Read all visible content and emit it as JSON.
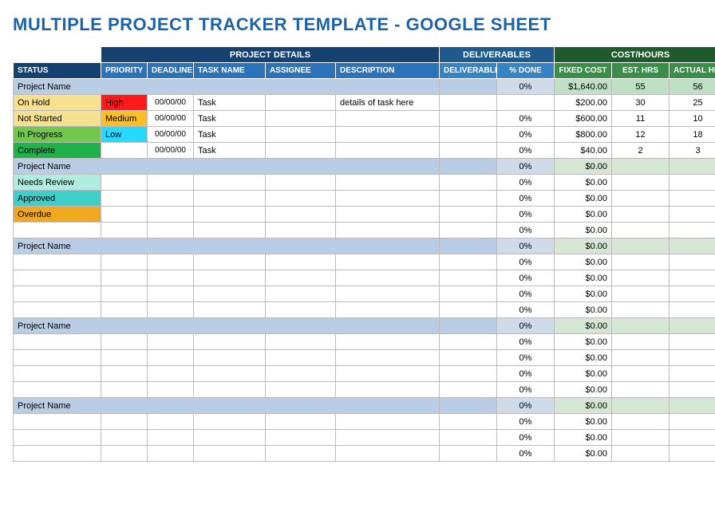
{
  "title": "MULTIPLE PROJECT TRACKER TEMPLATE - GOOGLE SHEET",
  "groups": {
    "project_details": "PROJECT DETAILS",
    "deliverables": "DELIVERABLES",
    "cost_hours": "COST/HOURS"
  },
  "cols": {
    "status": "STATUS",
    "priority": "PRIORITY",
    "deadline": "DEADLINE",
    "task": "TASK NAME",
    "assignee": "ASSIGNEE",
    "desc": "DESCRIPTION",
    "deliverable": "DELIVERABLE",
    "done": "% DONE",
    "cost": "FIXED COST",
    "est": "EST. HRS",
    "act": "ACTUAL HRS"
  },
  "projects": [
    {
      "name": "Project Name",
      "first": true,
      "done": "0%",
      "cost": "$1,640.00",
      "est": "55",
      "act": "56",
      "rows": [
        {
          "status": "On Hold",
          "status_cls": "st-onhold",
          "priority": "High",
          "priority_cls": "pr-high",
          "deadline": "00/00/00",
          "task": "Task",
          "assignee": "",
          "desc": "details of task here",
          "deliv": "",
          "done": "",
          "cost": "$200.00",
          "est": "30",
          "act": "25"
        },
        {
          "status": "Not Started",
          "status_cls": "st-notstart",
          "priority": "Medium",
          "priority_cls": "pr-medium",
          "deadline": "00/00/00",
          "task": "Task",
          "assignee": "",
          "desc": "",
          "deliv": "",
          "done": "0%",
          "cost": "$600.00",
          "est": "11",
          "act": "10"
        },
        {
          "status": "In Progress",
          "status_cls": "st-inprog",
          "priority": "Low",
          "priority_cls": "pr-low",
          "deadline": "00/00/00",
          "task": "Task",
          "assignee": "",
          "desc": "",
          "deliv": "",
          "done": "0%",
          "cost": "$800.00",
          "est": "12",
          "act": "18"
        },
        {
          "status": "Complete",
          "status_cls": "st-complete",
          "priority": "",
          "priority_cls": "",
          "deadline": "00/00/00",
          "task": "Task",
          "assignee": "",
          "desc": "",
          "deliv": "",
          "done": "0%",
          "cost": "$40.00",
          "est": "2",
          "act": "3"
        }
      ]
    },
    {
      "name": "Project Name",
      "first": false,
      "done": "0%",
      "cost": "$0.00",
      "est": "",
      "act": "",
      "rows": [
        {
          "status": "Needs Review",
          "status_cls": "st-needsrev",
          "priority": "",
          "priority_cls": "",
          "deadline": "",
          "task": "",
          "assignee": "",
          "desc": "",
          "deliv": "",
          "done": "0%",
          "cost": "$0.00",
          "est": "",
          "act": ""
        },
        {
          "status": "Approved",
          "status_cls": "st-approved",
          "priority": "",
          "priority_cls": "",
          "deadline": "",
          "task": "",
          "assignee": "",
          "desc": "",
          "deliv": "",
          "done": "0%",
          "cost": "$0.00",
          "est": "",
          "act": ""
        },
        {
          "status": "Overdue",
          "status_cls": "st-overdue",
          "priority": "",
          "priority_cls": "",
          "deadline": "",
          "task": "",
          "assignee": "",
          "desc": "",
          "deliv": "",
          "done": "0%",
          "cost": "$0.00",
          "est": "",
          "act": ""
        },
        {
          "status": "",
          "status_cls": "",
          "priority": "",
          "priority_cls": "",
          "deadline": "",
          "task": "",
          "assignee": "",
          "desc": "",
          "deliv": "",
          "done": "0%",
          "cost": "$0.00",
          "est": "",
          "act": ""
        }
      ]
    },
    {
      "name": "Project Name",
      "first": false,
      "done": "0%",
      "cost": "$0.00",
      "est": "",
      "act": "",
      "rows": [
        {
          "status": "",
          "status_cls": "",
          "priority": "",
          "priority_cls": "",
          "deadline": "",
          "task": "",
          "assignee": "",
          "desc": "",
          "deliv": "",
          "done": "0%",
          "cost": "$0.00",
          "est": "",
          "act": ""
        },
        {
          "status": "",
          "status_cls": "",
          "priority": "",
          "priority_cls": "",
          "deadline": "",
          "task": "",
          "assignee": "",
          "desc": "",
          "deliv": "",
          "done": "0%",
          "cost": "$0.00",
          "est": "",
          "act": ""
        },
        {
          "status": "",
          "status_cls": "",
          "priority": "",
          "priority_cls": "",
          "deadline": "",
          "task": "",
          "assignee": "",
          "desc": "",
          "deliv": "",
          "done": "0%",
          "cost": "$0.00",
          "est": "",
          "act": ""
        },
        {
          "status": "",
          "status_cls": "",
          "priority": "",
          "priority_cls": "",
          "deadline": "",
          "task": "",
          "assignee": "",
          "desc": "",
          "deliv": "",
          "done": "0%",
          "cost": "$0.00",
          "est": "",
          "act": ""
        }
      ]
    },
    {
      "name": "Project Name",
      "first": false,
      "done": "0%",
      "cost": "$0.00",
      "est": "",
      "act": "",
      "rows": [
        {
          "status": "",
          "status_cls": "",
          "priority": "",
          "priority_cls": "",
          "deadline": "",
          "task": "",
          "assignee": "",
          "desc": "",
          "deliv": "",
          "done": "0%",
          "cost": "$0.00",
          "est": "",
          "act": ""
        },
        {
          "status": "",
          "status_cls": "",
          "priority": "",
          "priority_cls": "",
          "deadline": "",
          "task": "",
          "assignee": "",
          "desc": "",
          "deliv": "",
          "done": "0%",
          "cost": "$0.00",
          "est": "",
          "act": ""
        },
        {
          "status": "",
          "status_cls": "",
          "priority": "",
          "priority_cls": "",
          "deadline": "",
          "task": "",
          "assignee": "",
          "desc": "",
          "deliv": "",
          "done": "0%",
          "cost": "$0.00",
          "est": "",
          "act": ""
        },
        {
          "status": "",
          "status_cls": "",
          "priority": "",
          "priority_cls": "",
          "deadline": "",
          "task": "",
          "assignee": "",
          "desc": "",
          "deliv": "",
          "done": "0%",
          "cost": "$0.00",
          "est": "",
          "act": ""
        }
      ]
    },
    {
      "name": "Project Name",
      "first": false,
      "done": "0%",
      "cost": "$0.00",
      "est": "",
      "act": "",
      "rows": [
        {
          "status": "",
          "status_cls": "",
          "priority": "",
          "priority_cls": "",
          "deadline": "",
          "task": "",
          "assignee": "",
          "desc": "",
          "deliv": "",
          "done": "0%",
          "cost": "$0.00",
          "est": "",
          "act": ""
        },
        {
          "status": "",
          "status_cls": "",
          "priority": "",
          "priority_cls": "",
          "deadline": "",
          "task": "",
          "assignee": "",
          "desc": "",
          "deliv": "",
          "done": "0%",
          "cost": "$0.00",
          "est": "",
          "act": ""
        },
        {
          "status": "",
          "status_cls": "",
          "priority": "",
          "priority_cls": "",
          "deadline": "",
          "task": "",
          "assignee": "",
          "desc": "",
          "deliv": "",
          "done": "0%",
          "cost": "$0.00",
          "est": "",
          "act": ""
        }
      ]
    }
  ]
}
